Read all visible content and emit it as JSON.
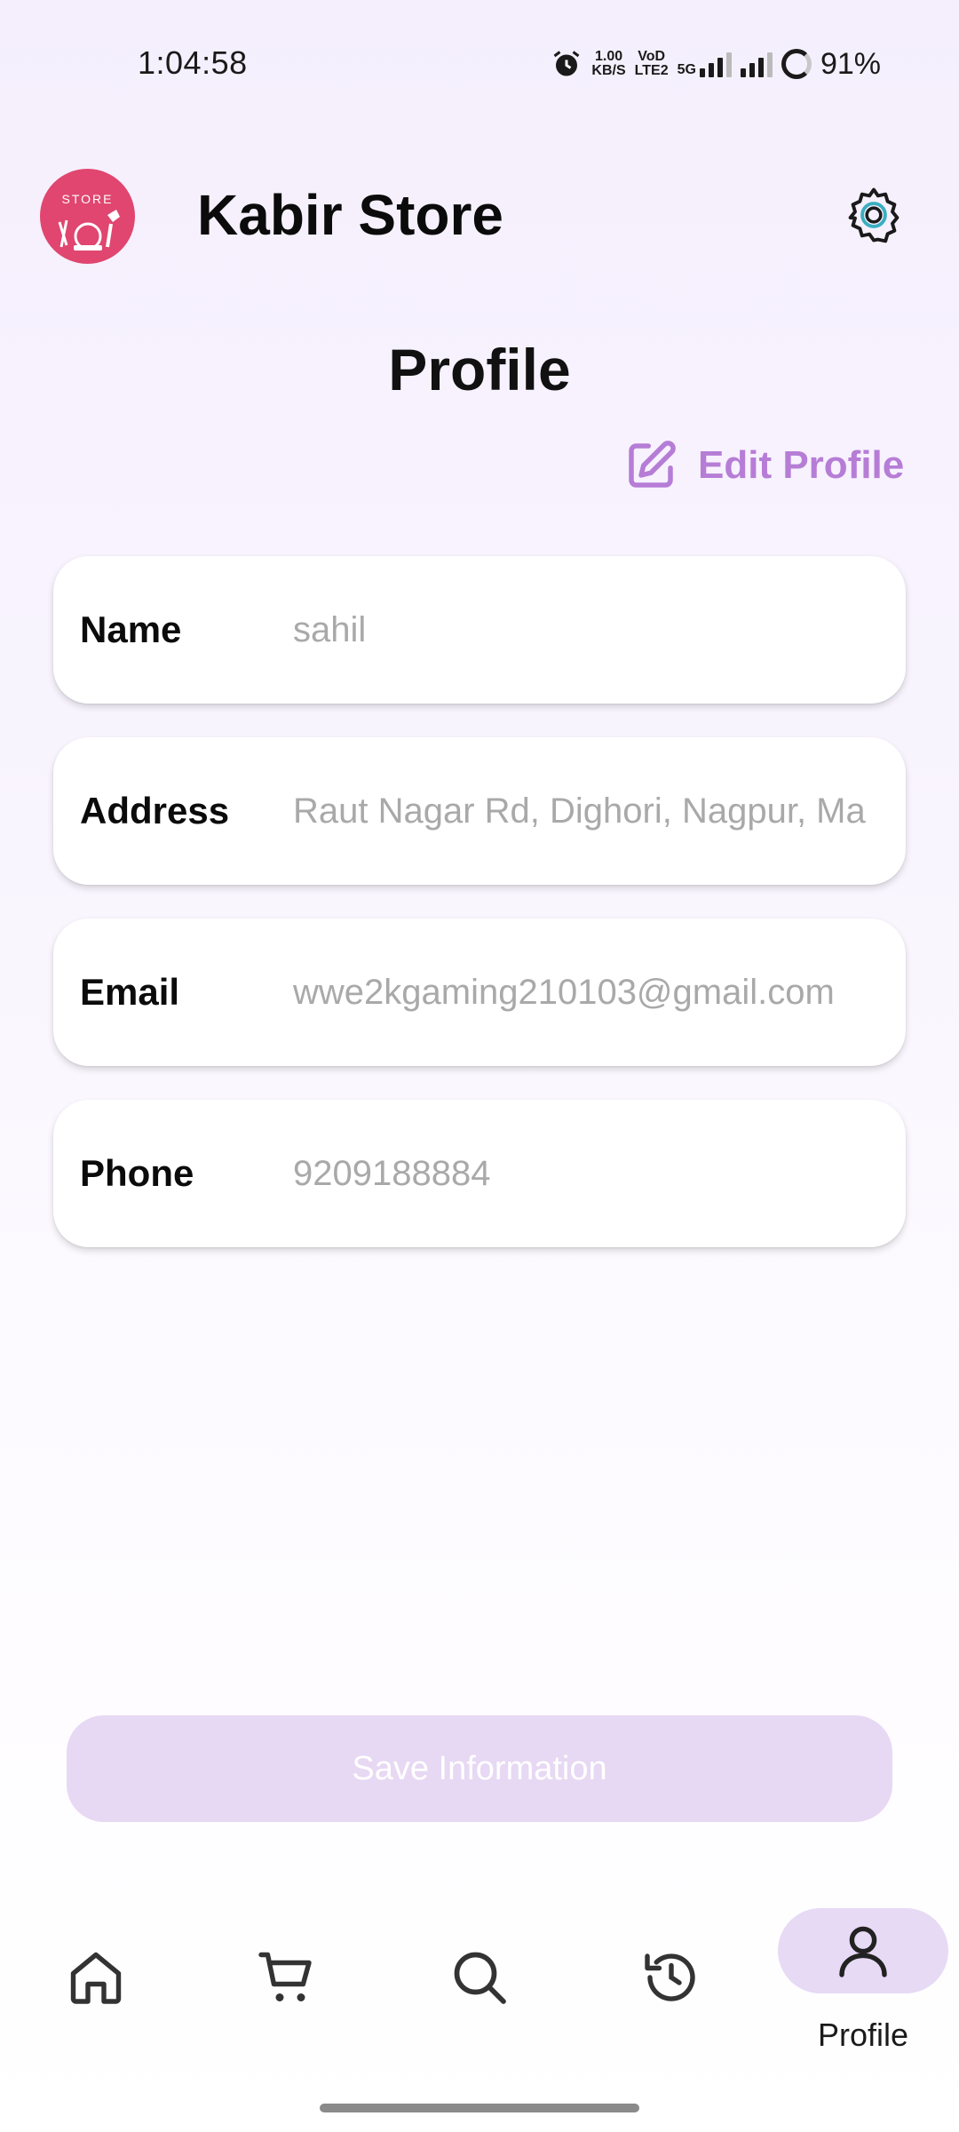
{
  "status_bar": {
    "time": "1:04:58",
    "net_speed_value": "1.00",
    "net_speed_unit": "KB/S",
    "volte_top": "VoD",
    "volte_bottom": "LTE2",
    "fiveg": "5G",
    "battery": "91%"
  },
  "header": {
    "logo_text": "STORE",
    "title": "Kabir Store",
    "settings_icon": "gear-icon"
  },
  "page": {
    "title": "Profile",
    "edit_label": "Edit Profile",
    "accent_color": "#b67dd6"
  },
  "fields": [
    {
      "label": "Name",
      "value": "sahil"
    },
    {
      "label": "Address",
      "value": "Raut Nagar Rd, Dighori, Nagpur, Ma"
    },
    {
      "label": "Email",
      "value": "wwe2kgaming210103@gmail.com"
    },
    {
      "label": "Phone",
      "value": "9209188884"
    }
  ],
  "save_button": {
    "label": "Save Information",
    "state": "disabled"
  },
  "bottom_nav": {
    "items": [
      {
        "icon": "home-icon"
      },
      {
        "icon": "cart-icon"
      },
      {
        "icon": "search-icon"
      },
      {
        "icon": "history-icon"
      },
      {
        "icon": "person-icon",
        "label": "Profile",
        "active": true
      }
    ]
  }
}
